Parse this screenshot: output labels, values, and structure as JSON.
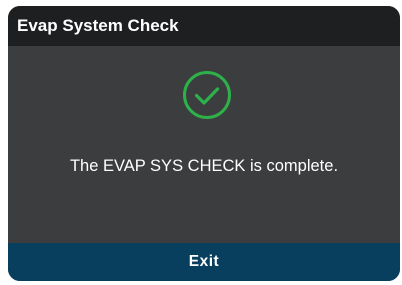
{
  "dialog": {
    "title": "Evap System Check",
    "status_icon": "check-circle-icon",
    "status_color": "#2db24a",
    "message": "The EVAP SYS CHECK is complete.",
    "exit_label": "Exit"
  }
}
